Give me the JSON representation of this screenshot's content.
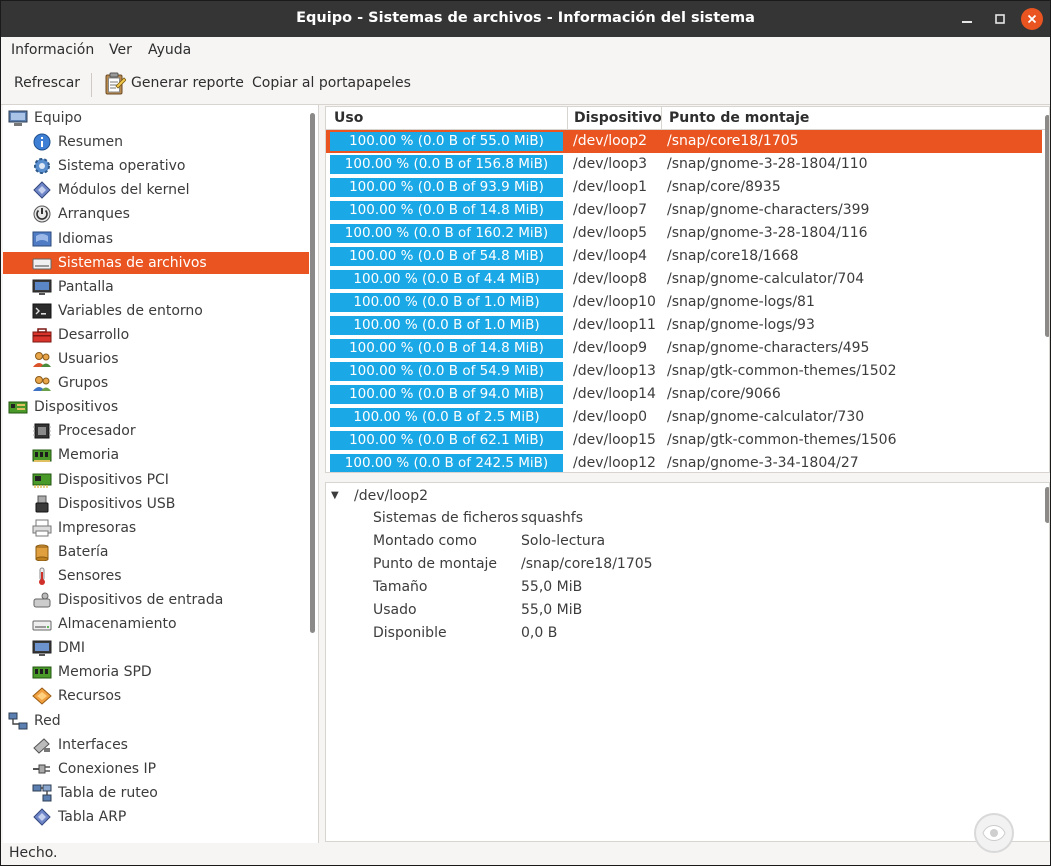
{
  "window": {
    "title": "Equipo - Sistemas de archivos - Información del sistema"
  },
  "menu": [
    "Información",
    "Ver",
    "Ayuda"
  ],
  "toolbar": {
    "refresh": "Refrescar",
    "report": "Generar reporte",
    "copy": "Copiar al portapapeles"
  },
  "sidebar": {
    "items": [
      {
        "label": "Equipo",
        "icon": "computer-icon",
        "level": 0
      },
      {
        "label": "Resumen",
        "icon": "summary-icon",
        "level": 1
      },
      {
        "label": "Sistema operativo",
        "icon": "os-gear-icon",
        "level": 1
      },
      {
        "label": "Módulos del kernel",
        "icon": "kernel-module-icon",
        "level": 1
      },
      {
        "label": "Arranques",
        "icon": "power-icon",
        "level": 1
      },
      {
        "label": "Idiomas",
        "icon": "language-flag-icon",
        "level": 1
      },
      {
        "label": "Sistemas de archivos",
        "icon": "drive-icon",
        "level": 1,
        "selected": true
      },
      {
        "label": "Pantalla",
        "icon": "monitor-icon",
        "level": 1
      },
      {
        "label": "Variables de entorno",
        "icon": "terminal-icon",
        "level": 1
      },
      {
        "label": "Desarrollo",
        "icon": "toolbox-icon",
        "level": 1
      },
      {
        "label": "Usuarios",
        "icon": "users-icon",
        "level": 1
      },
      {
        "label": "Grupos",
        "icon": "groups-icon",
        "level": 1
      },
      {
        "label": "Dispositivos",
        "icon": "board-icon",
        "level": 0
      },
      {
        "label": "Procesador",
        "icon": "cpu-icon",
        "level": 1
      },
      {
        "label": "Memoria",
        "icon": "memory-icon",
        "level": 1
      },
      {
        "label": "Dispositivos PCI",
        "icon": "pci-card-icon",
        "level": 1
      },
      {
        "label": "Dispositivos USB",
        "icon": "usb-icon",
        "level": 1
      },
      {
        "label": "Impresoras",
        "icon": "printer-icon",
        "level": 1
      },
      {
        "label": "Batería",
        "icon": "battery-icon",
        "level": 1
      },
      {
        "label": "Sensores",
        "icon": "thermometer-icon",
        "level": 1
      },
      {
        "label": "Dispositivos de entrada",
        "icon": "input-device-icon",
        "level": 1
      },
      {
        "label": "Almacenamiento",
        "icon": "storage-icon",
        "level": 1
      },
      {
        "label": "DMI",
        "icon": "dmi-monitor-icon",
        "level": 1
      },
      {
        "label": "Memoria SPD",
        "icon": "spd-memory-icon",
        "level": 1
      },
      {
        "label": "Recursos",
        "icon": "resources-icon",
        "level": 1
      },
      {
        "label": "Red",
        "icon": "network-icon",
        "level": 0
      },
      {
        "label": "Interfaces",
        "icon": "interfaces-icon",
        "level": 1
      },
      {
        "label": "Conexiones IP",
        "icon": "ip-connections-icon",
        "level": 1
      },
      {
        "label": "Tabla de ruteo",
        "icon": "routing-table-icon",
        "level": 1
      },
      {
        "label": "Tabla ARP",
        "icon": "arp-table-icon",
        "level": 1
      }
    ]
  },
  "table": {
    "headers": [
      "Uso",
      "Dispositivo",
      "Punto de montaje"
    ],
    "rows": [
      {
        "usage": "100.00 % (0.0 B of 55.0 MiB)",
        "device": "/dev/loop2",
        "mount": "/snap/core18/1705",
        "fill": 1.0,
        "selected": true
      },
      {
        "usage": "100.00 % (0.0 B of 156.8 MiB)",
        "device": "/dev/loop3",
        "mount": "/snap/gnome-3-28-1804/110",
        "fill": 1.0
      },
      {
        "usage": "100.00 % (0.0 B of 93.9 MiB)",
        "device": "/dev/loop1",
        "mount": "/snap/core/8935",
        "fill": 1.0
      },
      {
        "usage": "100.00 % (0.0 B of 14.8 MiB)",
        "device": "/dev/loop7",
        "mount": "/snap/gnome-characters/399",
        "fill": 1.0
      },
      {
        "usage": "100.00 % (0.0 B of 160.2 MiB)",
        "device": "/dev/loop5",
        "mount": "/snap/gnome-3-28-1804/116",
        "fill": 1.0
      },
      {
        "usage": "100.00 % (0.0 B of 54.8 MiB)",
        "device": "/dev/loop4",
        "mount": "/snap/core18/1668",
        "fill": 1.0
      },
      {
        "usage": "100.00 % (0.0 B of 4.4 MiB)",
        "device": "/dev/loop8",
        "mount": "/snap/gnome-calculator/704",
        "fill": 1.0
      },
      {
        "usage": "100.00 % (0.0 B of 1.0 MiB)",
        "device": "/dev/loop10",
        "mount": "/snap/gnome-logs/81",
        "fill": 1.0
      },
      {
        "usage": "100.00 % (0.0 B of 1.0 MiB)",
        "device": "/dev/loop11",
        "mount": "/snap/gnome-logs/93",
        "fill": 1.0
      },
      {
        "usage": "100.00 % (0.0 B of 14.8 MiB)",
        "device": "/dev/loop9",
        "mount": "/snap/gnome-characters/495",
        "fill": 1.0
      },
      {
        "usage": "100.00 % (0.0 B of 54.9 MiB)",
        "device": "/dev/loop13",
        "mount": "/snap/gtk-common-themes/1502",
        "fill": 1.0
      },
      {
        "usage": "100.00 % (0.0 B of 94.0 MiB)",
        "device": "/dev/loop14",
        "mount": "/snap/core/9066",
        "fill": 1.0
      },
      {
        "usage": "100.00 % (0.0 B of 2.5 MiB)",
        "device": "/dev/loop0",
        "mount": "/snap/gnome-calculator/730",
        "fill": 1.0
      },
      {
        "usage": "100.00 % (0.0 B of 62.1 MiB)",
        "device": "/dev/loop15",
        "mount": "/snap/gtk-common-themes/1506",
        "fill": 1.0
      },
      {
        "usage": "100.00 % (0.0 B of 242.5 MiB)",
        "device": "/dev/loop12",
        "mount": "/snap/gnome-3-34-1804/27",
        "fill": 1.0
      }
    ]
  },
  "detail": {
    "title": "/dev/loop2",
    "rows": [
      {
        "key": "Sistemas de ficheros",
        "value": "squashfs"
      },
      {
        "key": "Montado como",
        "value": "Solo-lectura"
      },
      {
        "key": "Punto de montaje",
        "value": "/snap/core18/1705"
      },
      {
        "key": "Tamaño",
        "value": "55,0 MiB"
      },
      {
        "key": "Usado",
        "value": "55,0 MiB"
      },
      {
        "key": "Disponible",
        "value": "0,0 B"
      }
    ]
  },
  "status": "Hecho.",
  "colors": {
    "accent": "#e95420",
    "usage_bar": "#1aa8e6",
    "titlebar": "#353535"
  }
}
